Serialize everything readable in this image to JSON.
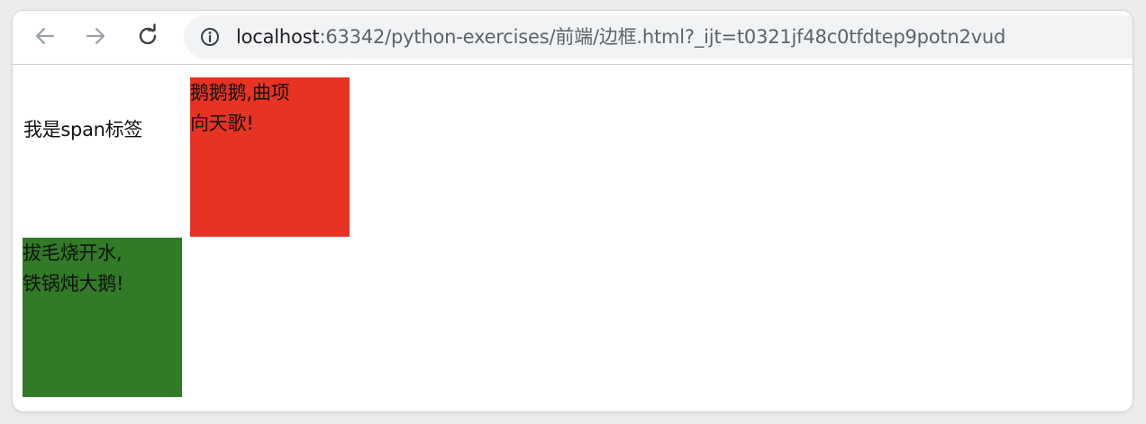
{
  "browser": {
    "url_host": "localhost",
    "url_rest": ":63342/python-exercises/前端/边框.html?_ijt=t0321jf48c0tfdtep9potn2vud",
    "icons": {
      "back": "arrow-left-icon",
      "forward": "arrow-right-icon",
      "reload": "reload-icon",
      "site_info": "info-icon"
    }
  },
  "page": {
    "span_text": "我是span标签",
    "red_box": {
      "line1": "鹅鹅鹅,曲项",
      "line2": "向天歌!",
      "color": "#e83323"
    },
    "green_box": {
      "line1": "拔毛烧开水,",
      "line2": "铁锅炖大鹅!",
      "color": "#317a26"
    }
  }
}
